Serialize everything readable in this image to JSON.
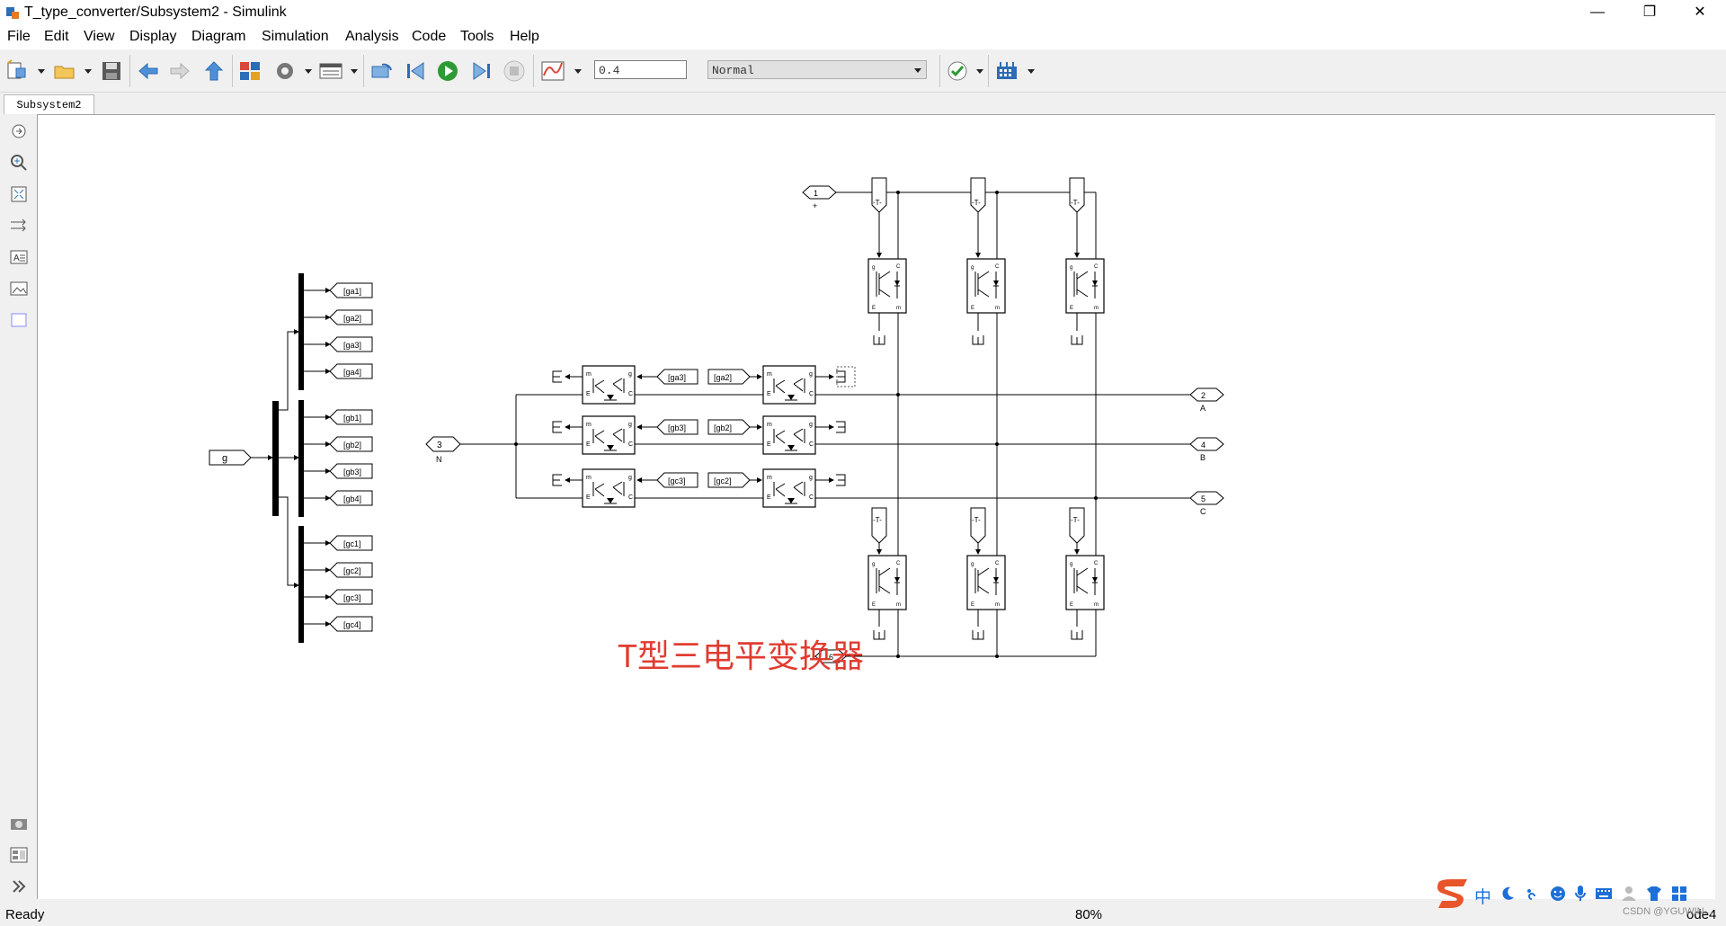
{
  "window": {
    "title": "T_type_converter/Subsystem2 - Simulink",
    "controls": {
      "minimize": "—",
      "maximize": "❐",
      "close": "✕"
    }
  },
  "menu": [
    "File",
    "Edit",
    "View",
    "Display",
    "Diagram",
    "Simulation",
    "Analysis",
    "Code",
    "Tools",
    "Help"
  ],
  "toolbar": {
    "stop_time": "0.4",
    "sim_mode": "Normal",
    "icons": [
      "new-model-icon",
      "open-icon",
      "save-icon",
      "back-icon",
      "forward-icon",
      "up-icon",
      "library-browser-icon",
      "model-settings-icon",
      "model-explorer-icon",
      "step-back-icon",
      "run-icon",
      "step-forward-icon",
      "stop-icon",
      "data-inspector-icon",
      "check-icon",
      "build-icon"
    ]
  },
  "tabs": [
    "Subsystem2"
  ],
  "palette": [
    "hide-show-icon",
    "zoom-in-icon",
    "fit-view-icon",
    "route-lines-icon",
    "annotation-icon",
    "image-icon",
    "area-icon",
    "screenshot-icon",
    "model-browser-icon",
    "expand-icon"
  ],
  "diagram": {
    "gate_input": "g",
    "goto_tags": [
      [
        "[ga1]",
        "[ga2]",
        "[ga3]",
        "[ga4]"
      ],
      [
        "[gb1]",
        "[gb2]",
        "[gb3]",
        "[gb4]"
      ],
      [
        "[gc1]",
        "[gc2]",
        "[gc3]",
        "[gc4]"
      ]
    ],
    "from_tags_left": [
      "[ga3]",
      "[gb3]",
      "[gc3]"
    ],
    "from_tags_right": [
      "[ga2]",
      "[gb2]",
      "[gc2]"
    ],
    "dc_pos_port": "1",
    "dc_pos_sign": "+",
    "neutral_port": "3",
    "neutral_label": "N",
    "output_ports": [
      {
        "num": "2",
        "label": "A"
      },
      {
        "num": "4",
        "label": "B"
      },
      {
        "num": "5",
        "label": "C"
      }
    ],
    "upper_gate_tags": [
      "-T-",
      "-T-",
      "-T-"
    ],
    "lower_gate_tags": [
      "-T-",
      "-T-",
      "-T-"
    ],
    "dc_neg_port": "6",
    "annotation": "T型三电平变换器",
    "annotation_color": "#e03c31"
  },
  "status": {
    "ready": "Ready",
    "zoom": "80%",
    "solver": "ode4"
  },
  "ime": {
    "chinese": "中"
  },
  "watermark": "CSDN @YGUWIN..."
}
